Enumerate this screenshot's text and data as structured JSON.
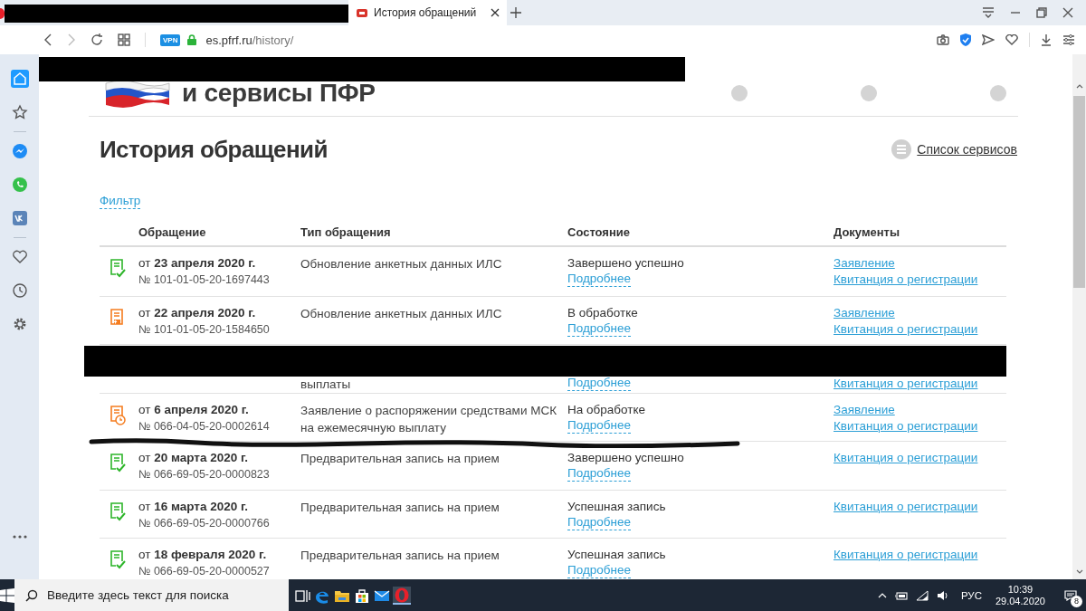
{
  "browser": {
    "tabs": [
      {
        "title": "История обращений",
        "selected": true
      }
    ],
    "address": {
      "vpn_badge": "VPN",
      "host": "es.pfrf.ru",
      "path": "/history/"
    }
  },
  "sidebar": {
    "items": [
      {
        "kind": "home",
        "selected": true
      },
      {
        "kind": "star",
        "selected": false
      },
      {
        "kind": "divider"
      },
      {
        "kind": "messenger",
        "selected": false
      },
      {
        "kind": "whatsapp",
        "selected": false
      },
      {
        "kind": "vk",
        "selected": false
      },
      {
        "kind": "divider"
      },
      {
        "kind": "heart",
        "selected": false
      },
      {
        "kind": "clock",
        "selected": false
      },
      {
        "kind": "gear",
        "selected": false
      }
    ]
  },
  "site_header": {
    "logo_text": "и сервисы ПФР"
  },
  "page": {
    "title": "История обращений",
    "services_link": "Список сервисов",
    "filter_link": "Фильтр"
  },
  "table": {
    "columns": [
      "Обращение",
      "Тип обращения",
      "Состояние",
      "Документы"
    ],
    "rows": [
      {
        "kind": "done",
        "date": "от **23 апреля 2020 г.**",
        "number": "№ 101-01-05-20-1697443",
        "type": "Обновление анкетных данных ИЛС",
        "state": "Завершено успешно",
        "details": "Подробнее",
        "documents": [
          "Заявление",
          "Квитанция о регистрации"
        ]
      },
      {
        "kind": "upload",
        "date": "от **22 апреля 2020 г.**",
        "number": "№ 101-01-05-20-1584650",
        "type": "Обновление анкетных данных ИЛС",
        "state": "В обработке",
        "details": "Подробнее",
        "documents": [
          "Заявление",
          "Квитанция о регистрации"
        ]
      },
      {
        "kind": "redacted",
        "type": "выплаты",
        "details": "Подробнее",
        "documents": [
          "Квитанция о регистрации"
        ]
      },
      {
        "kind": "clock",
        "date": "от **6 апреля 2020 г.**",
        "number": "№ 066-04-05-20-0002614",
        "type": "Заявление о распоряжении средствами МСК на ежемесячную выплату",
        "state": "На обработке",
        "details": "Подробнее",
        "documents": [
          "Заявление",
          "Квитанция о регистрации"
        ]
      },
      {
        "kind": "done",
        "date": "от **20 марта 2020 г.**",
        "number": "№ 066-69-05-20-0000823",
        "type": "Предварительная запись на прием",
        "state": "Завершено успешно",
        "details": "Подробнее",
        "documents": [
          "Квитанция о регистрации"
        ]
      },
      {
        "kind": "done",
        "date": "от **16 марта 2020 г.**",
        "number": "№ 066-69-05-20-0000766",
        "type": "Предварительная запись на прием",
        "state": "Успешная запись",
        "details": "Подробнее",
        "documents": [
          "Квитанция о регистрации"
        ]
      },
      {
        "kind": "done",
        "date": "от **18 февраля 2020 г.**",
        "number": "№ 066-69-05-20-0000527",
        "type": "Предварительная запись на прием",
        "state": "Успешная запись",
        "details": "Подробнее",
        "documents": [
          "Квитанция о регистрации"
        ]
      }
    ]
  },
  "taskbar": {
    "search_placeholder": "Введите здесь текст для поиска",
    "apps": [
      {
        "kind": "taskview",
        "selected": false
      },
      {
        "kind": "edge",
        "selected": false
      },
      {
        "kind": "explorer",
        "selected": false
      },
      {
        "kind": "store",
        "selected": false
      },
      {
        "kind": "mail",
        "selected": false
      },
      {
        "kind": "opera",
        "selected": true
      }
    ],
    "language": "РУС",
    "time": "10:39",
    "date": "29.04.2020",
    "notifications": "8"
  }
}
